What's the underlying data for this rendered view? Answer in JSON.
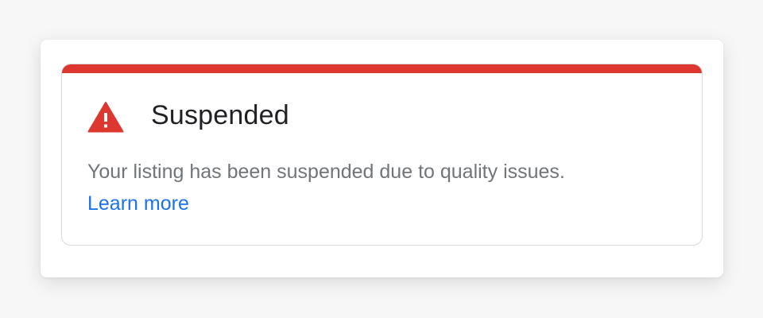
{
  "status_card": {
    "icon": "warning-triangle-icon",
    "title": "Suspended",
    "message": "Your listing has been suspended due to quality issues.",
    "link_label": "Learn more"
  },
  "colors": {
    "accent_red": "#dd3730",
    "link_blue": "#1a73e8",
    "title_text": "#202124",
    "body_text": "#70757a"
  }
}
